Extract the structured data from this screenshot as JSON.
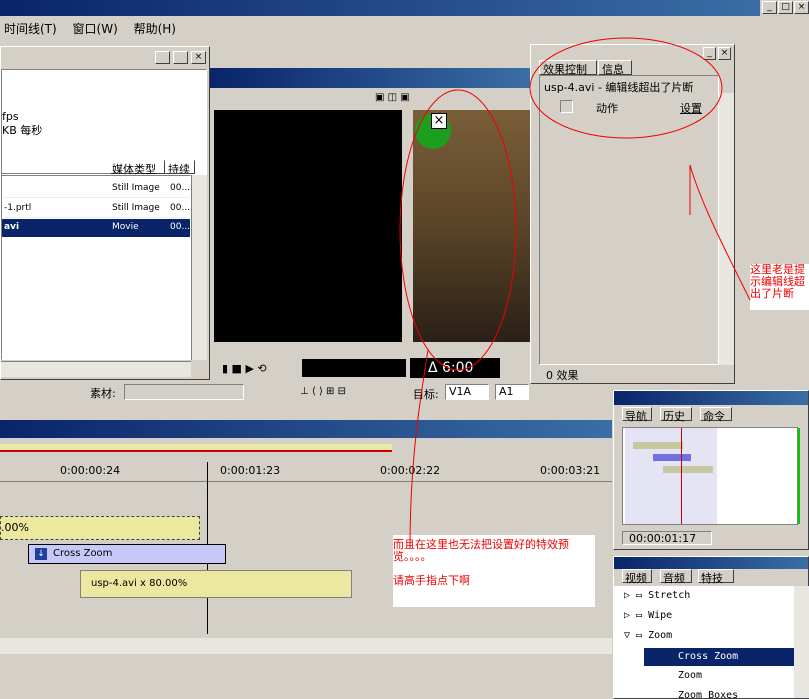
{
  "menu": {
    "timeline": "时间线(T)",
    "window": "窗口(W)",
    "help": "帮助(H)"
  },
  "project": {
    "fps": "fps",
    "rate": "KB 每秒",
    "col_media": "媒体类型",
    "col_dur": "持续",
    "rows": [
      {
        "name": "",
        "type": "Still Image",
        "dur": "00..."
      },
      {
        "name": "-1.prtl",
        "type": "Still Image",
        "dur": "00..."
      },
      {
        "name": "avi",
        "type": "Movie",
        "dur": "00..."
      }
    ]
  },
  "monitor": {
    "timecode": "Δ 6:00",
    "source_label": "素材:",
    "target_label": "目标:",
    "v1": "V1A",
    "a1": "A1"
  },
  "effects": {
    "tab_effect": "效果控制",
    "tab_info": "信息",
    "clip_msg": "usp-4.avi - 编辑线超出了片断",
    "action": "动作",
    "setup": "设置",
    "count": "0 效果"
  },
  "navigator": {
    "tab_nav": "导航",
    "tab_history": "历史",
    "tab_cmd": "命令",
    "timecode": "00:00:01:17"
  },
  "transitions": {
    "tab_video": "视频",
    "tab_audio": "音频",
    "tab_fx": "特技",
    "items": [
      "Stretch",
      "Wipe",
      "Zoom",
      "Cross Zoom",
      "Zoom",
      "Zoom Boxes"
    ]
  },
  "timeline": {
    "times": [
      "0:00:00:24",
      "0:00:01:23",
      "0:00:02:22",
      "0:00:03:21"
    ],
    "clip1": ".00%",
    "transition": "Cross Zoom",
    "clip2": "usp-4.avi x 80.00%"
  },
  "annotations": {
    "right": "这里老是提示编辑线超出了片断",
    "bottom1": "而且在这里也无法把设置好的特效预览。。。。",
    "bottom2": "请高手指点下啊"
  }
}
